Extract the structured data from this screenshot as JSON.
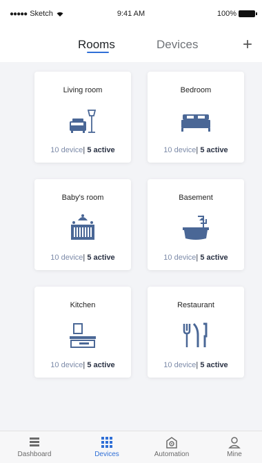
{
  "status_bar": {
    "carrier": "Sketch",
    "time": "9:41 AM",
    "battery": "100%"
  },
  "tabs": [
    {
      "label": "Rooms"
    },
    {
      "label": "Devices"
    }
  ],
  "rooms": [
    {
      "name": "Living room",
      "devices": "10 device",
      "active": "5 active",
      "icon": "sofa-lamp-icon"
    },
    {
      "name": "Bedroom",
      "devices": "10 device",
      "active": "5 active",
      "icon": "bed-icon"
    },
    {
      "name": "Baby's room",
      "devices": "10 device",
      "active": "5 active",
      "icon": "crib-icon"
    },
    {
      "name": "Basement",
      "devices": "10 device",
      "active": "5 active",
      "icon": "bathtub-icon"
    },
    {
      "name": "Kitchen",
      "devices": "10 device",
      "active": "5 active",
      "icon": "stove-hood-icon"
    },
    {
      "name": "Restaurant",
      "devices": "10 device",
      "active": "5 active",
      "icon": "cutlery-icon"
    }
  ],
  "bottom_nav": [
    {
      "label": "Dashboard",
      "icon": "dashboard-icon"
    },
    {
      "label": "Devices",
      "icon": "devices-grid-icon"
    },
    {
      "label": "Automation",
      "icon": "automation-house-icon"
    },
    {
      "label": "Mine",
      "icon": "user-icon"
    }
  ],
  "colors": {
    "accent": "#2f6fd6",
    "icon_blue": "#4a6796",
    "meta_text": "#7c8aa8"
  }
}
